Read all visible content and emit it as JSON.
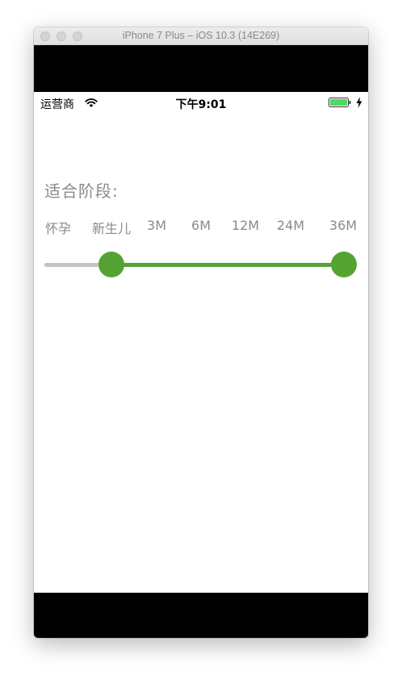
{
  "window": {
    "title": "iPhone 7 Plus – iOS 10.3 (14E269)"
  },
  "status_bar": {
    "carrier": "运营商",
    "time": "下午9:01",
    "wifi_icon": "wifi-icon",
    "battery_icon": "battery-icon",
    "battery_level": 1.0,
    "charging_icon": "charging-bolt-icon"
  },
  "stage_picker": {
    "title": "适合阶段:",
    "stages": [
      "怀孕",
      "新生儿",
      "3M",
      "6M",
      "12M",
      "24M",
      "36M"
    ],
    "selected_min": "新生儿",
    "selected_max": "36M",
    "colors": {
      "active": "#55a333",
      "inactive": "#c4c4c4",
      "label": "#8a8a8a"
    }
  }
}
